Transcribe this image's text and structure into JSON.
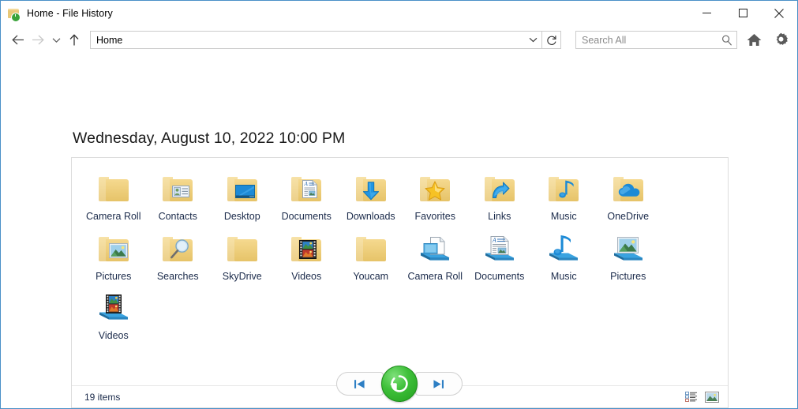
{
  "window": {
    "title": "Home - File History",
    "title_icon": "folder-history-icon",
    "minimize_label": "Minimize",
    "maximize_label": "Maximize",
    "close_label": "Close"
  },
  "toolbar": {
    "back_label": "Back",
    "forward_label": "Forward",
    "history_label": "Recent locations",
    "up_label": "Up",
    "address_value": "Home",
    "refresh_label": "Refresh",
    "home_label": "Home",
    "settings_label": "Settings"
  },
  "search": {
    "placeholder": "Search All",
    "value": ""
  },
  "main": {
    "date_heading": "Wednesday, August 10, 2022 10:00 PM",
    "status": "19 items",
    "items": [
      {
        "label": "Camera Roll",
        "icon": "folder-plain-icon",
        "kind": "folder"
      },
      {
        "label": "Contacts",
        "icon": "folder-contacts-icon",
        "kind": "folder"
      },
      {
        "label": "Desktop",
        "icon": "folder-desktop-icon",
        "kind": "folder"
      },
      {
        "label": "Documents",
        "icon": "folder-documents-icon",
        "kind": "folder"
      },
      {
        "label": "Downloads",
        "icon": "folder-downloads-icon",
        "kind": "folder"
      },
      {
        "label": "Favorites",
        "icon": "folder-favorites-icon",
        "kind": "folder"
      },
      {
        "label": "Links",
        "icon": "folder-links-icon",
        "kind": "folder"
      },
      {
        "label": "Music",
        "icon": "folder-music-icon",
        "kind": "folder"
      },
      {
        "label": "OneDrive",
        "icon": "folder-onedrive-icon",
        "kind": "folder"
      },
      {
        "label": "Pictures",
        "icon": "folder-pictures-icon",
        "kind": "folder"
      },
      {
        "label": "Searches",
        "icon": "folder-searches-icon",
        "kind": "folder"
      },
      {
        "label": "SkyDrive",
        "icon": "folder-plain-icon",
        "kind": "folder"
      },
      {
        "label": "Videos",
        "icon": "folder-videos-icon",
        "kind": "folder"
      },
      {
        "label": "Youcam",
        "icon": "folder-plain-icon",
        "kind": "folder"
      },
      {
        "label": "Camera Roll",
        "icon": "library-camera-roll-icon",
        "kind": "library"
      },
      {
        "label": "Documents",
        "icon": "library-documents-icon",
        "kind": "library"
      },
      {
        "label": "Music",
        "icon": "library-music-icon",
        "kind": "library"
      },
      {
        "label": "Pictures",
        "icon": "library-pictures-icon",
        "kind": "library"
      },
      {
        "label": "Videos",
        "icon": "library-videos-icon",
        "kind": "library"
      }
    ],
    "view_details_label": "Details view",
    "view_icons_label": "Large icons view"
  },
  "bottom_nav": {
    "previous_label": "Previous version",
    "restore_label": "Restore to original location",
    "next_label": "Next version"
  },
  "colors": {
    "window_border": "#4a90c8",
    "restore_green": "#3fc03a",
    "folder_yellow": "#f0d184",
    "accent_blue": "#1a8fe0",
    "label_text": "#1a2a4a"
  }
}
